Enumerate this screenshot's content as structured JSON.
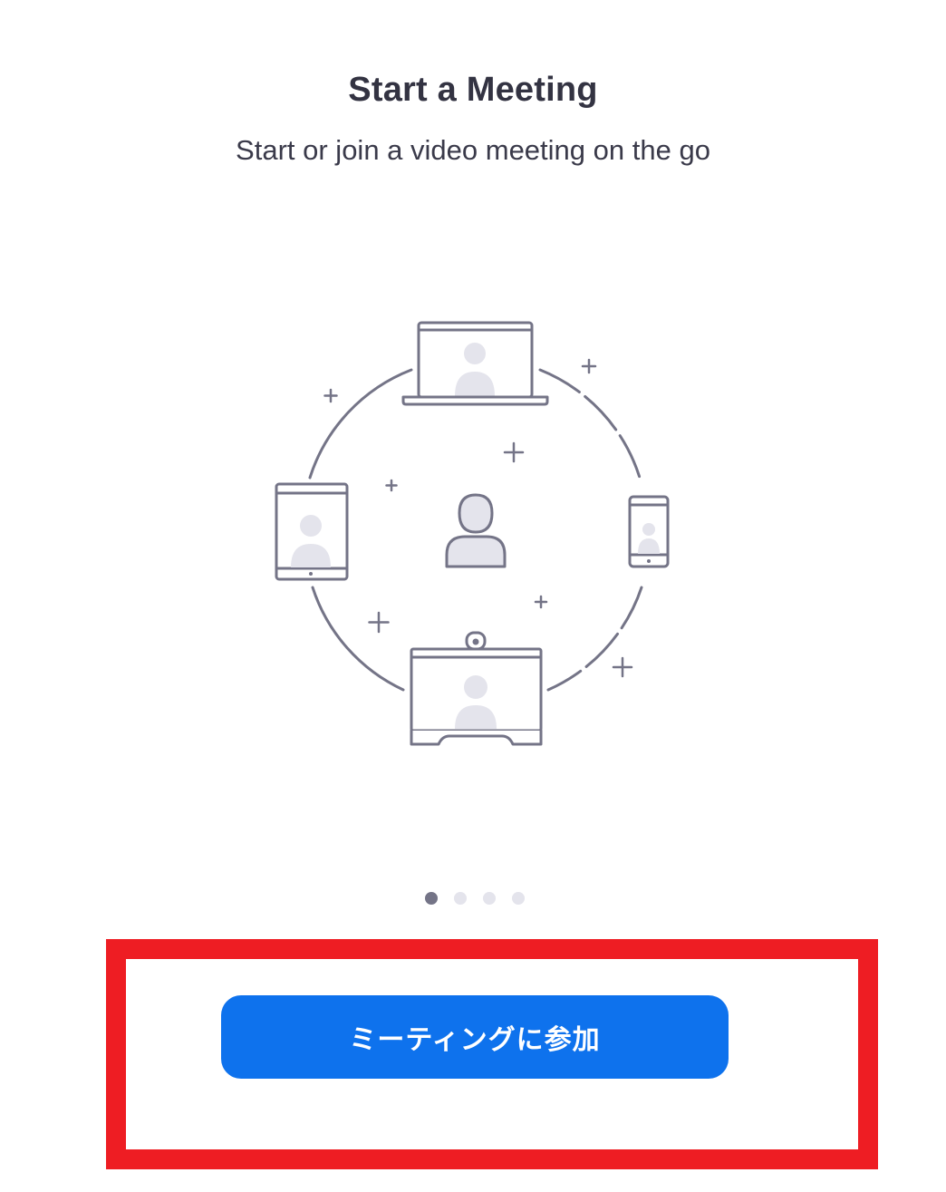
{
  "onboarding": {
    "title": "Start a Meeting",
    "subtitle": "Start or join a video meeting on the go",
    "page_indicator": {
      "total_pages": 4,
      "current_page": 1
    }
  },
  "actions": {
    "join_meeting_label": "ミーティングに参加"
  },
  "colors": {
    "primary_button": "#0e72ed",
    "highlight_border": "#ee1d23",
    "illustration_stroke": "#747487",
    "avatar_fill": "#e4e4ec"
  },
  "icons": [
    "laptop-icon",
    "tablet-icon",
    "phone-icon",
    "room-system-icon",
    "user-icon",
    "plus-icon"
  ]
}
